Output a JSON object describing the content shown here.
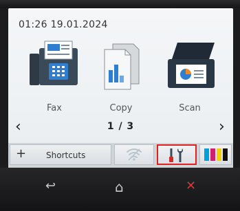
{
  "status": {
    "datetime": "01:26 19.01.2024"
  },
  "apps": [
    {
      "label": "Fax",
      "icon": "fax-icon"
    },
    {
      "label": "Copy",
      "icon": "copy-icon"
    },
    {
      "label": "Scan",
      "icon": "scan-icon"
    }
  ],
  "pager": {
    "indicator": "1 / 3",
    "prev": "‹",
    "next": "›"
  },
  "bottom_bar": {
    "shortcuts_label": "Shortcuts",
    "shortcuts_plus": "+",
    "tiles": [
      "wifi-icon",
      "tools-icon",
      "ink-icon"
    ]
  },
  "hardware_buttons": {
    "back": "↩",
    "home": "⌂",
    "cancel": "✕"
  },
  "colors": {
    "highlight": "#e02020",
    "cancel": "#d9343a",
    "ink_cyan": "#00a0d8",
    "ink_magenta": "#cf1f6e",
    "ink_yellow": "#f4d000",
    "ink_black": "#111111"
  }
}
